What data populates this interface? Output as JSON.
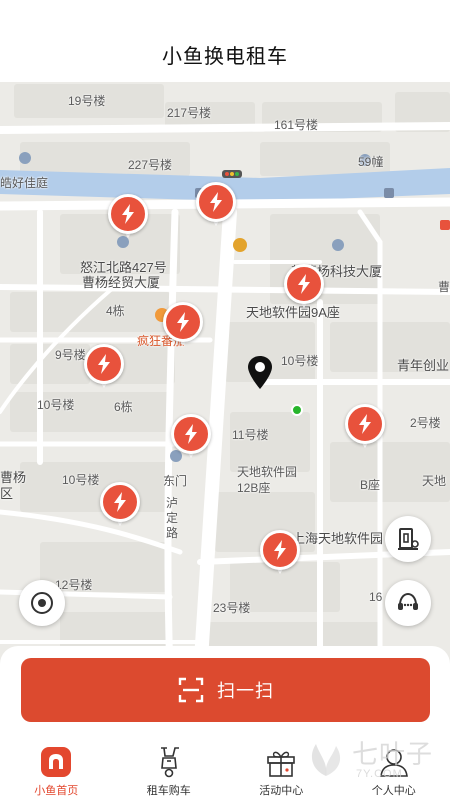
{
  "header": {
    "title": "小鱼换电租车"
  },
  "map": {
    "labels": {
      "bldg19": "19号楼",
      "bldg217": "217号楼",
      "bldg161": "161号楼",
      "bldg227": "227号楼",
      "bldg59": "59幢",
      "haojia": "皓好佳庭",
      "nujiang_427": "怒江北路427号",
      "caoyang_jingmao": "曹杨经贸大厦",
      "caoyang_keji": "新曹杨科技大厦",
      "cao_right": "曹",
      "dong4": "4栋",
      "tiandi_9a": "天地软件园9A座",
      "fengkuang": "疯狂番茄",
      "bldg9": "9号楼",
      "bldg10a": "10号楼",
      "qingnian": "青年创业",
      "bldg10b": "10号楼",
      "dong6": "6栋",
      "bldg11": "11号楼",
      "bldg2": "2号楼",
      "caoyang_district": "曹杨区",
      "bldg10c": "10号楼",
      "dongmen": "东门",
      "tiandi_12b": "天地软件园12B座",
      "b_zuo": "B座",
      "tiandi_right": "天地",
      "luding": "泸定路",
      "shanghai_tiandi": "上海天地软件园",
      "bldg12": "12号楼",
      "bldg23": "23号楼",
      "num16": "16"
    }
  },
  "scan_button": {
    "label": "扫一扫"
  },
  "tabs": [
    {
      "label": "小鱼首页",
      "icon": "home-icon",
      "active": true
    },
    {
      "label": "租车购车",
      "icon": "scooter-icon",
      "active": false
    },
    {
      "label": "活动中心",
      "icon": "gift-icon",
      "active": false
    },
    {
      "label": "个人中心",
      "icon": "person-icon",
      "active": false
    }
  ],
  "watermark": {
    "text": "七叶子",
    "url": "7Y.COM"
  },
  "colors": {
    "brand": "#dc4a2f",
    "station": "#e8523c",
    "active_tab": "#e3472e",
    "my_location": "#27b52b"
  }
}
